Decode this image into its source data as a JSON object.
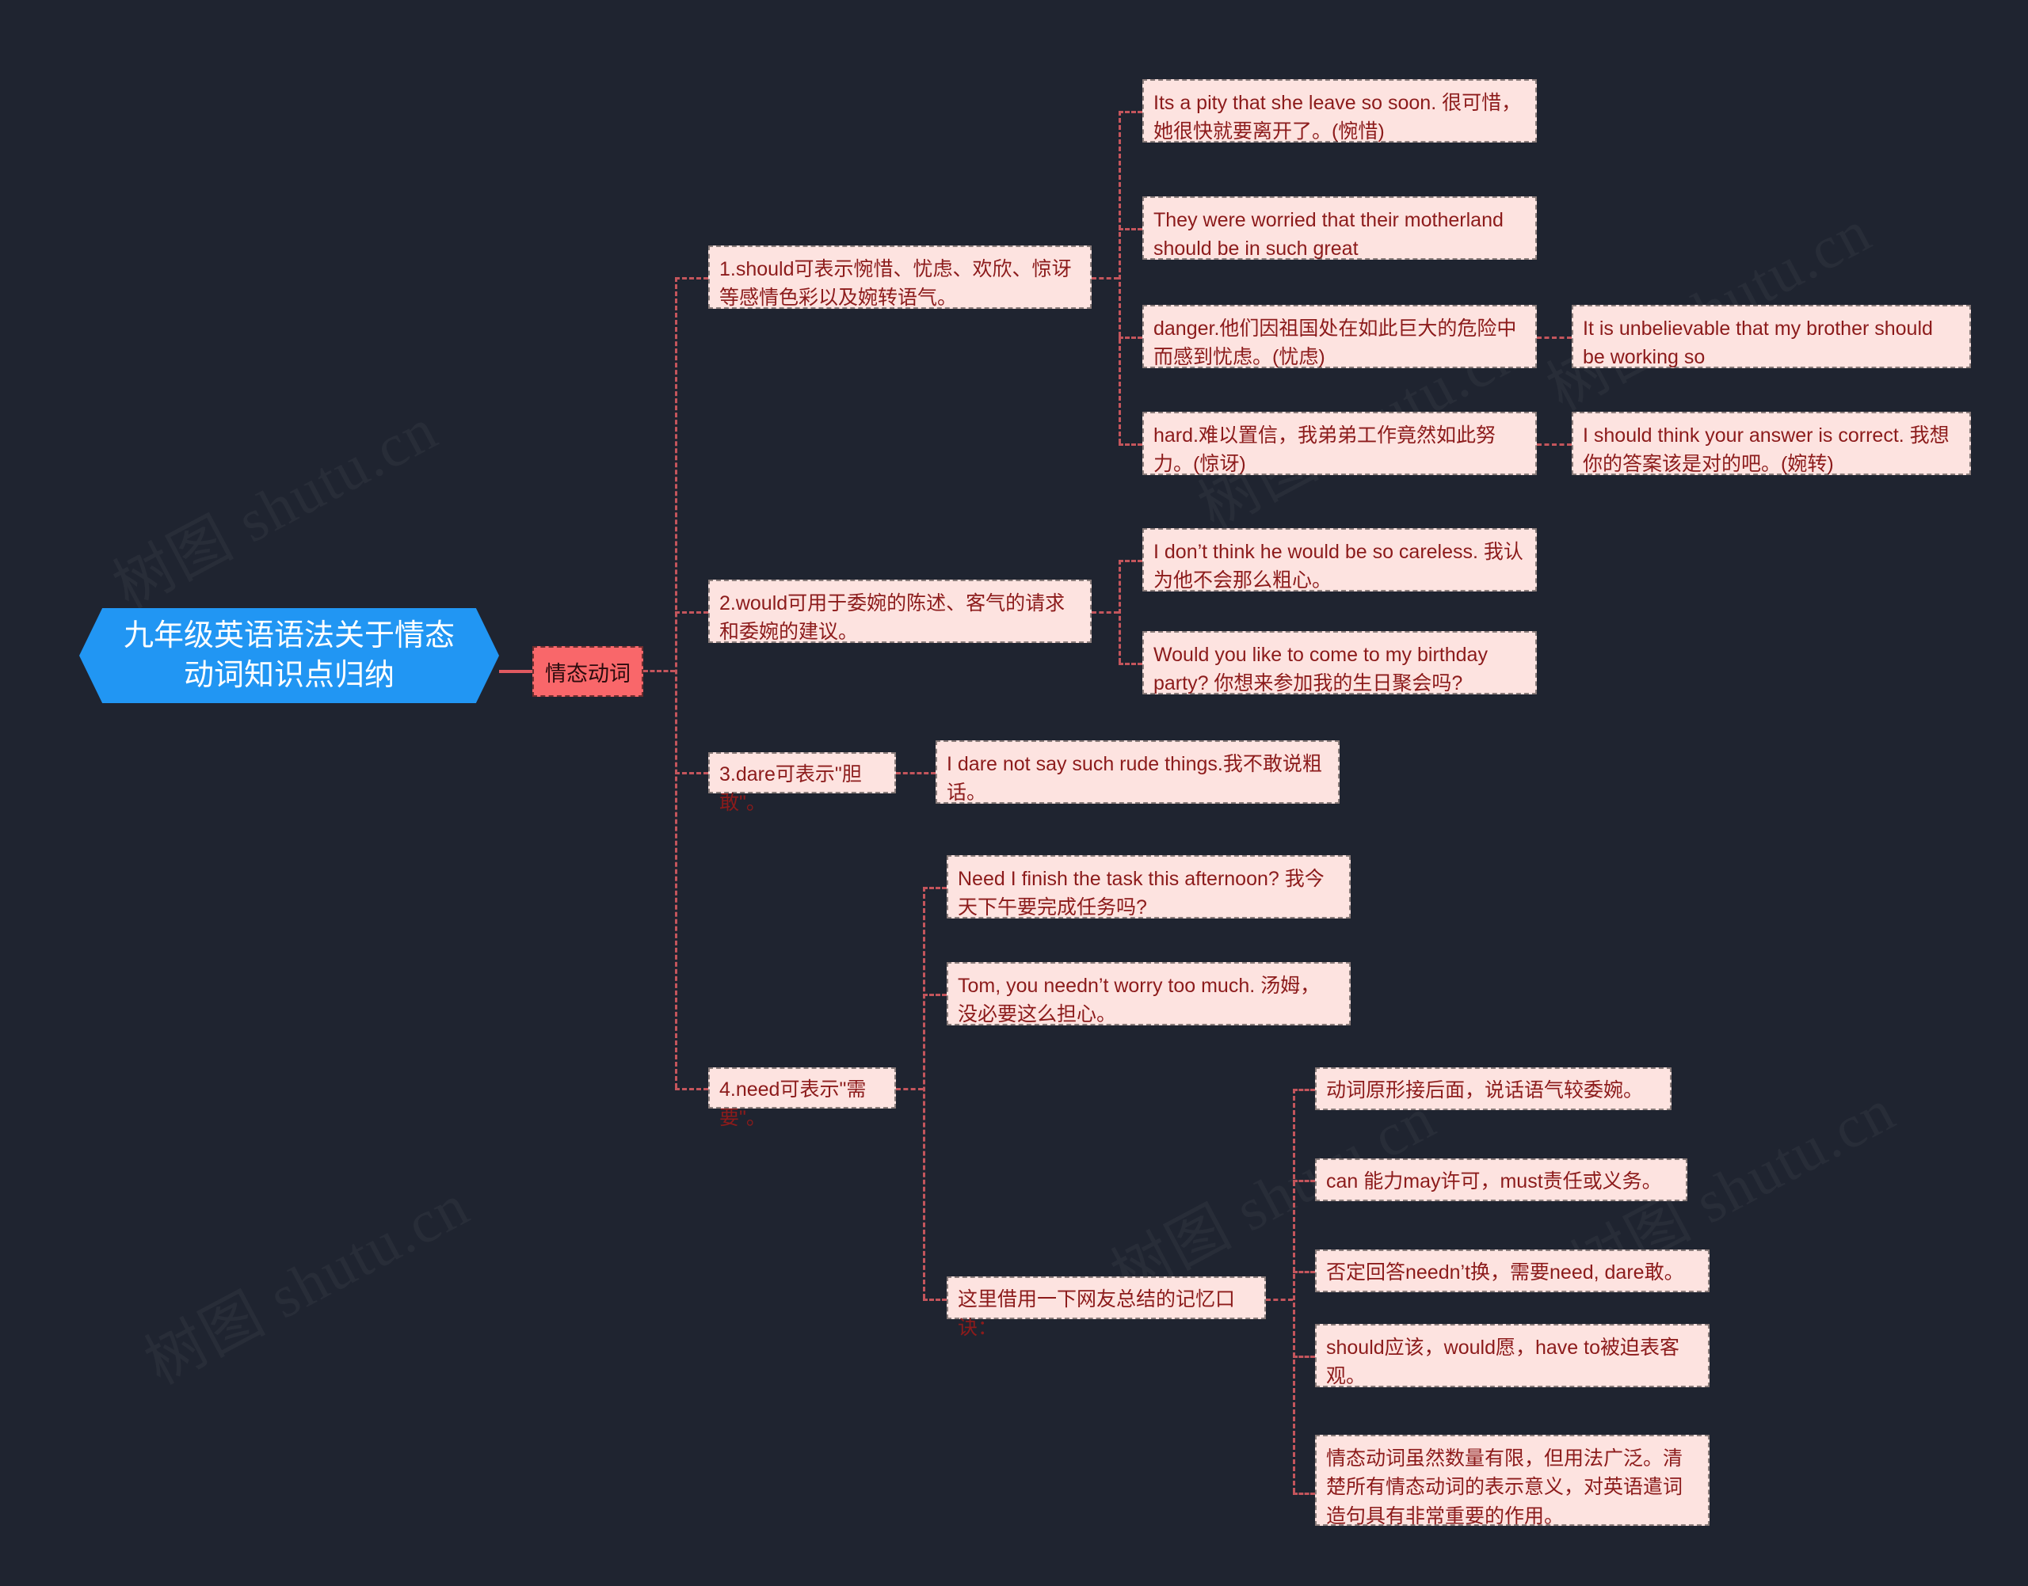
{
  "meta": {
    "background_color": "#1f2430",
    "root_color": "#2196f3",
    "level1_color": "#f9676a",
    "node_color": "#fde3e0",
    "node_text_color": "#8c1b1b",
    "connector_color": "#c4555c",
    "watermark_text": "树图 shutu.cn"
  },
  "root": {
    "line1": "九年级英语语法关于情态",
    "line2": "动词知识点归纳"
  },
  "level1": {
    "label": "情态动词"
  },
  "branches": [
    {
      "id": "should",
      "label": "1.should可表示惋惜、忧虑、欢欣、惊讶等感情色彩以及婉转语气。",
      "children": [
        "Its a pity that she leave so soon. 很可惜，她很快就要离开了。(惋惜)",
        "They were worried that their motherland should be in such great",
        "danger.他们因祖国处在如此巨大的危险中而感到忧虑。(忧虑)",
        "hard.难以置信，我弟弟工作竟然如此努力。(惊讶)"
      ],
      "grandchildren": [
        "It is unbelievable that my brother should be working so",
        "I should think your answer is correct. 我想你的答案该是对的吧。(婉转)"
      ]
    },
    {
      "id": "would",
      "label": "2.would可用于委婉的陈述、客气的请求和委婉的建议。",
      "children": [
        "I don’t think he would be so careless. 我认为他不会那么粗心。",
        "Would you like to come to my birthday party? 你想来参加我的生日聚会吗?"
      ]
    },
    {
      "id": "dare",
      "label": "3.dare可表示\"胆敢\"。",
      "children": [
        "I dare not say such rude things.我不敢说粗话。"
      ]
    },
    {
      "id": "need",
      "label": "4.need可表示\"需要\"。",
      "children": [
        "Need I finish the task this afternoon? 我今天下午要完成任务吗?",
        "Tom, you needn’t worry too much. 汤姆，没必要这么担心。",
        "这里借用一下网友总结的记忆口诀："
      ],
      "mnemonic_children": [
        "动词原形接后面，说话语气较委婉。",
        "can 能力may许可，must责任或义务。",
        "否定回答needn’t换，需要need, dare敢。",
        "should应该，would愿，have to被迫表客观。",
        "情态动词虽然数量有限，但用法广泛。清楚所有情态动词的表示意义，对英语遣词造句具有非常重要的作用。"
      ]
    }
  ]
}
